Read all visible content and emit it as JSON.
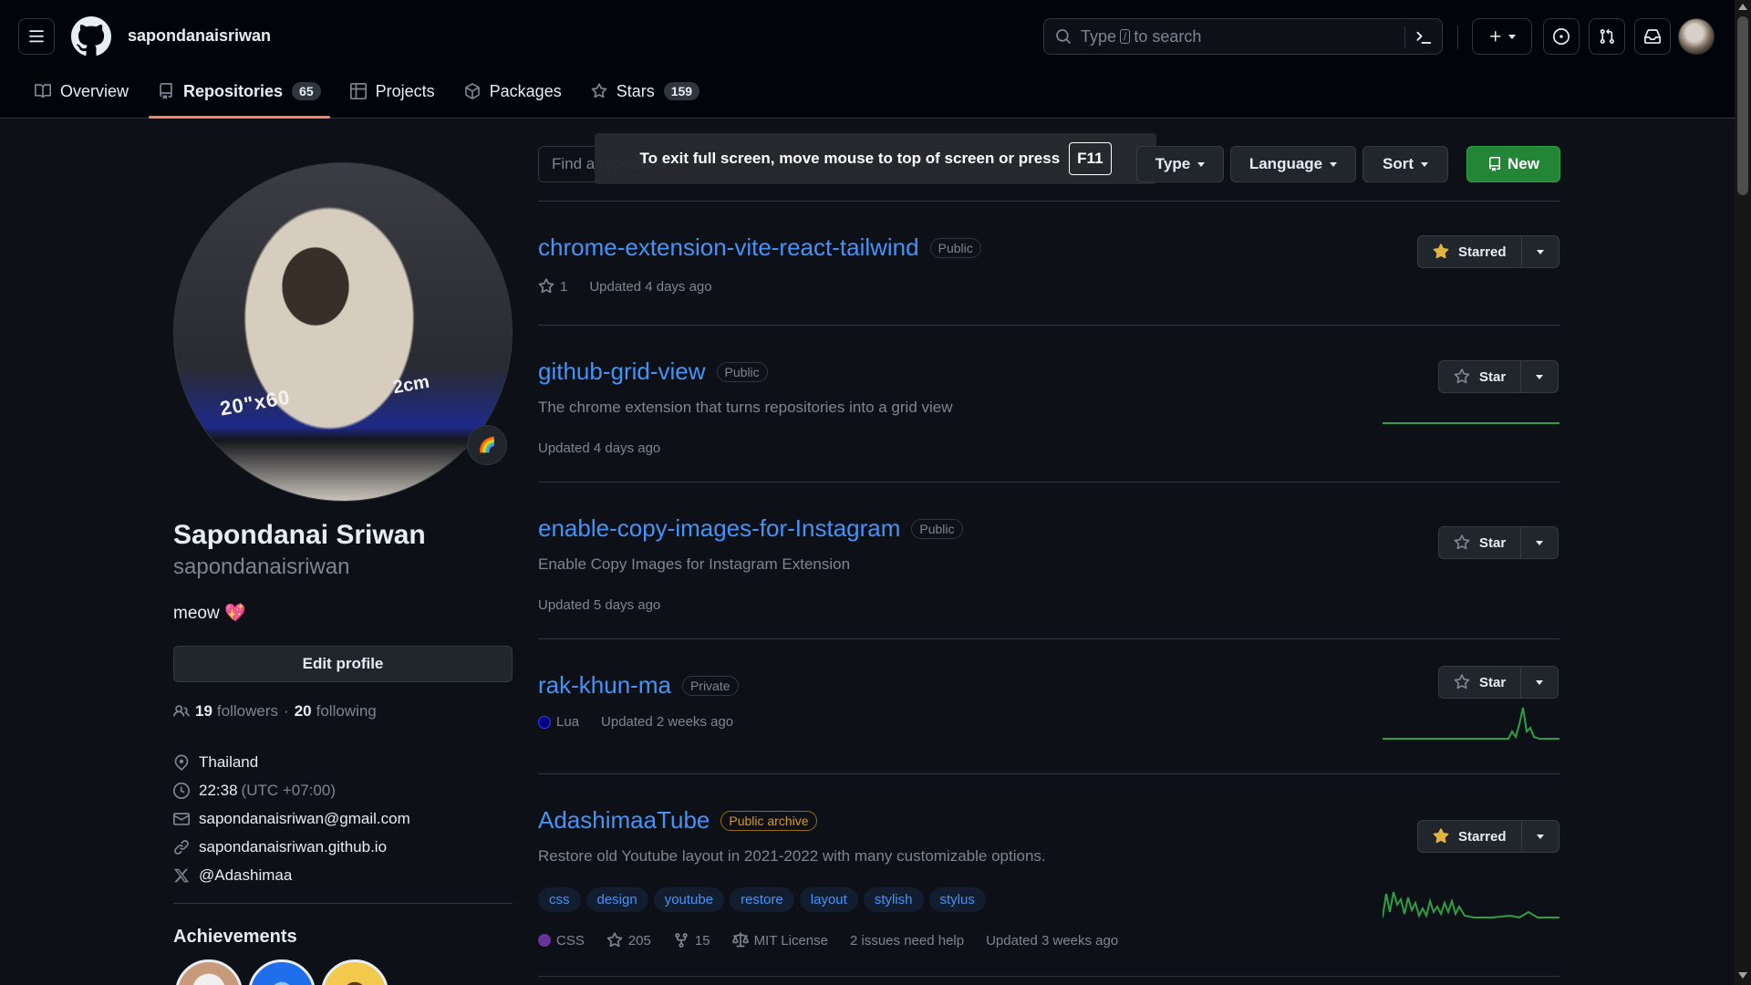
{
  "header": {
    "owner": "sapondanaisriwan",
    "search_prefix": "Type",
    "search_key": "/",
    "search_suffix": "to search"
  },
  "tabs": [
    {
      "label": "Overview",
      "icon": "book-icon"
    },
    {
      "label": "Repositories",
      "count": "65",
      "icon": "repo-icon"
    },
    {
      "label": "Projects",
      "icon": "table-icon"
    },
    {
      "label": "Packages",
      "icon": "package-icon"
    },
    {
      "label": "Stars",
      "count": "159",
      "icon": "star-icon"
    }
  ],
  "profile": {
    "avatar_text_1": "20\"x60",
    "avatar_text_2": "2cm",
    "status_emoji": "🌈",
    "full_name": "Sapondanai Sriwan",
    "login": "sapondanaisriwan",
    "bio": "meow",
    "bio_emoji": "💖",
    "edit_label": "Edit profile",
    "followers_count": "19",
    "followers_label": "followers",
    "separator": "·",
    "following_count": "20",
    "following_label": "following",
    "location": "Thailand",
    "local_time": "22:38",
    "timezone": "(UTC +07:00)",
    "email": "sapondanaisriwan@gmail.com",
    "website": "sapondanaisriwan.github.io",
    "twitter": "@Adashimaa",
    "achievements_title": "Achievements"
  },
  "filters": {
    "find_placeholder": "Find a repository...",
    "type_label": "Type",
    "language_label": "Language",
    "sort_label": "Sort",
    "new_label": "New"
  },
  "toast": {
    "message": "To exit full screen, move mouse to top of screen or press",
    "key": "F11"
  },
  "repos": [
    {
      "name": "chrome-extension-vite-react-tailwind",
      "visibility": "Public",
      "stars": "1",
      "updated": "Updated 4 days ago",
      "star_button": "Starred"
    },
    {
      "name": "github-grid-view",
      "visibility": "Public",
      "description": "The chrome extension that turns repositories into a grid view",
      "updated": "Updated 4 days ago",
      "star_button": "Star"
    },
    {
      "name": "enable-copy-images-for-Instagram",
      "visibility": "Public",
      "description": "Enable Copy Images for Instagram Extension",
      "updated": "Updated 5 days ago",
      "star_button": "Star"
    },
    {
      "name": "rak-khun-ma",
      "visibility": "Private",
      "language": "Lua",
      "language_color": "#000080",
      "updated": "Updated 2 weeks ago",
      "star_button": "Star"
    },
    {
      "name": "AdashimaaTube",
      "visibility": "Public archive",
      "description": "Restore old Youtube layout in 2021-2022 with many customizable options.",
      "topics": [
        "css",
        "design",
        "youtube",
        "restore",
        "layout",
        "stylish",
        "stylus"
      ],
      "language": "CSS",
      "language_color": "#663399",
      "stars": "205",
      "forks": "15",
      "license": "MIT License",
      "issues": "2 issues need help",
      "updated": "Updated 3 weeks ago",
      "star_button": "Starred"
    }
  ],
  "colors": {
    "accent": "#4493f8",
    "tab_underline": "#f78166",
    "new_button": "#238636",
    "starred_icon": "#e3b341",
    "sparkline": "#2ea043",
    "archive_label": "#d29922"
  }
}
